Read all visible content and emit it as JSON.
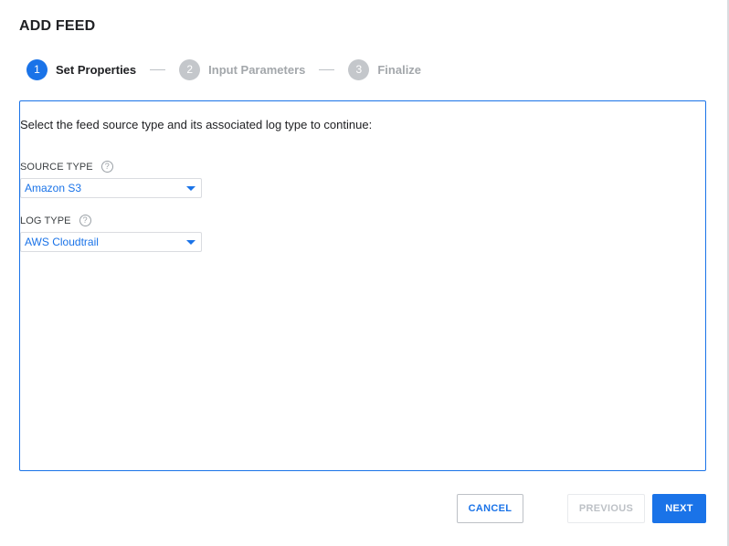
{
  "dialog": {
    "title": "ADD FEED"
  },
  "stepper": {
    "steps": [
      {
        "number": "1",
        "label": "Set Properties",
        "state": "active"
      },
      {
        "number": "2",
        "label": "Input Parameters",
        "state": "inactive"
      },
      {
        "number": "3",
        "label": "Finalize",
        "state": "inactive"
      }
    ]
  },
  "form": {
    "instruction": "Select the feed source type and its associated log type to continue:",
    "source_type": {
      "label": "SOURCE TYPE",
      "help_icon": "?",
      "value": "Amazon S3"
    },
    "log_type": {
      "label": "LOG TYPE",
      "help_icon": "?",
      "value": "AWS Cloudtrail"
    }
  },
  "footer": {
    "cancel_label": "CANCEL",
    "previous_label": "PREVIOUS",
    "next_label": "NEXT"
  },
  "colors": {
    "accent": "#1a73e8",
    "inactive_step": "#c4c7cb",
    "disabled_text": "#bdc1c6"
  },
  "icons": {
    "help": "help-circle-icon",
    "dropdown": "caret-down-icon"
  }
}
